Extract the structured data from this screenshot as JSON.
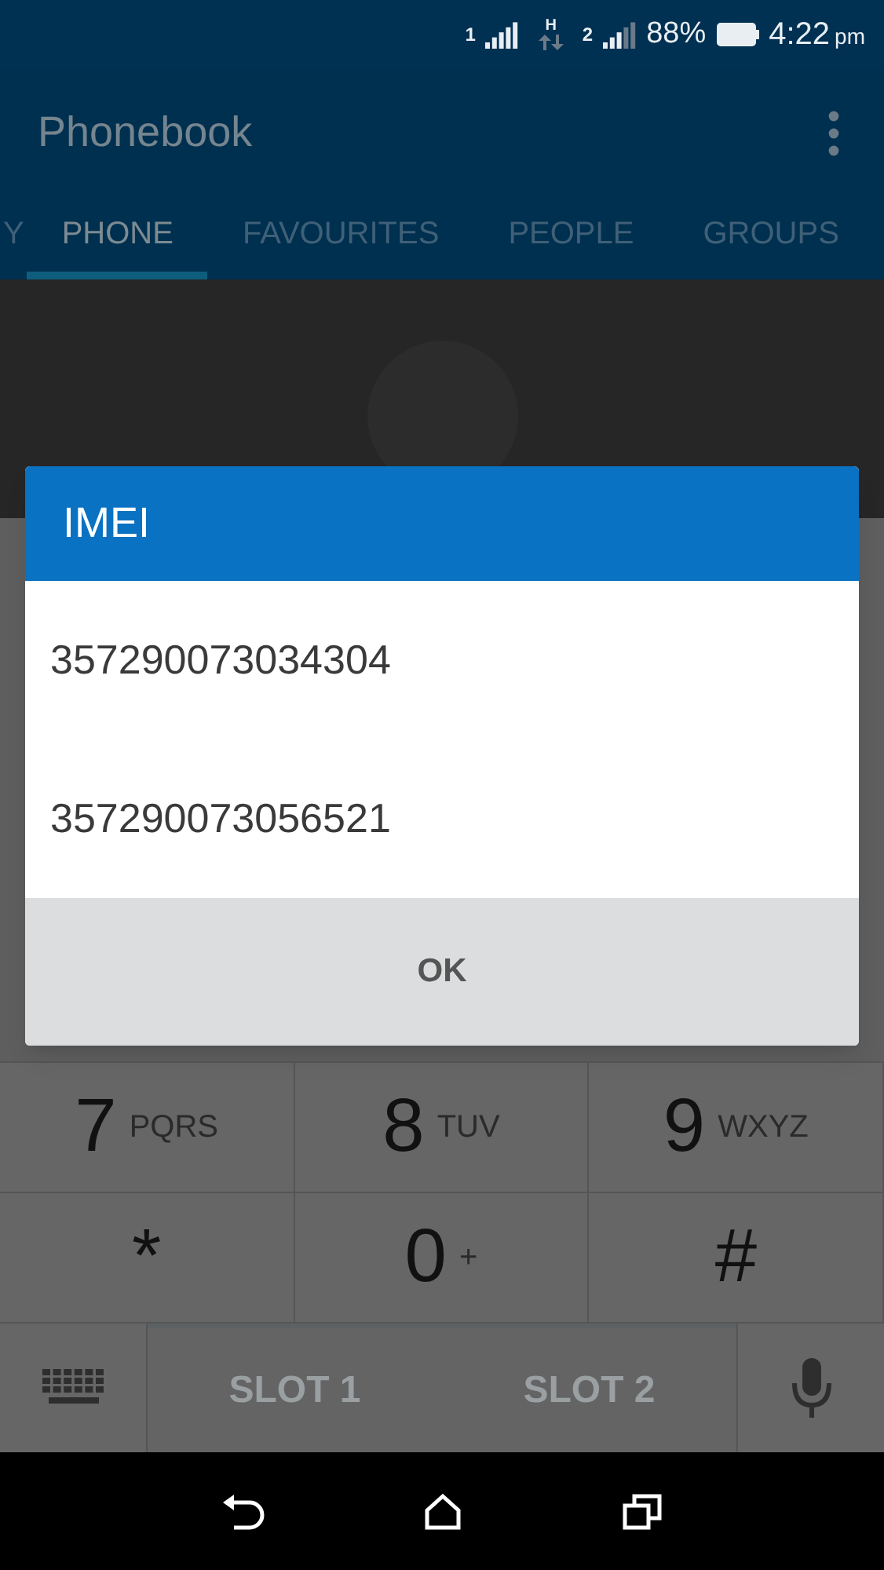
{
  "status_bar": {
    "sim1": "1",
    "sim2": "2",
    "network": "H",
    "battery": "88%",
    "time": "4:22",
    "ampm": "pm"
  },
  "app_bar": {
    "title": "Phonebook"
  },
  "tabs": [
    {
      "label": "Y",
      "selected": false
    },
    {
      "label": "PHONE",
      "selected": true
    },
    {
      "label": "FAVOURITES",
      "selected": false
    },
    {
      "label": "PEOPLE",
      "selected": false
    },
    {
      "label": "GROUPS",
      "selected": false
    }
  ],
  "keypad": [
    {
      "digit": "7",
      "letters": "PQRS"
    },
    {
      "digit": "8",
      "letters": "TUV"
    },
    {
      "digit": "9",
      "letters": "WXYZ"
    },
    {
      "digit": "*"
    },
    {
      "digit": "0",
      "letters": "+"
    },
    {
      "digit": "#"
    }
  ],
  "call_buttons": [
    "SLOT 1",
    "SLOT 2"
  ],
  "dialog": {
    "title": "IMEI",
    "items": [
      "357290073034304",
      "357290073056521"
    ],
    "button": "OK"
  }
}
